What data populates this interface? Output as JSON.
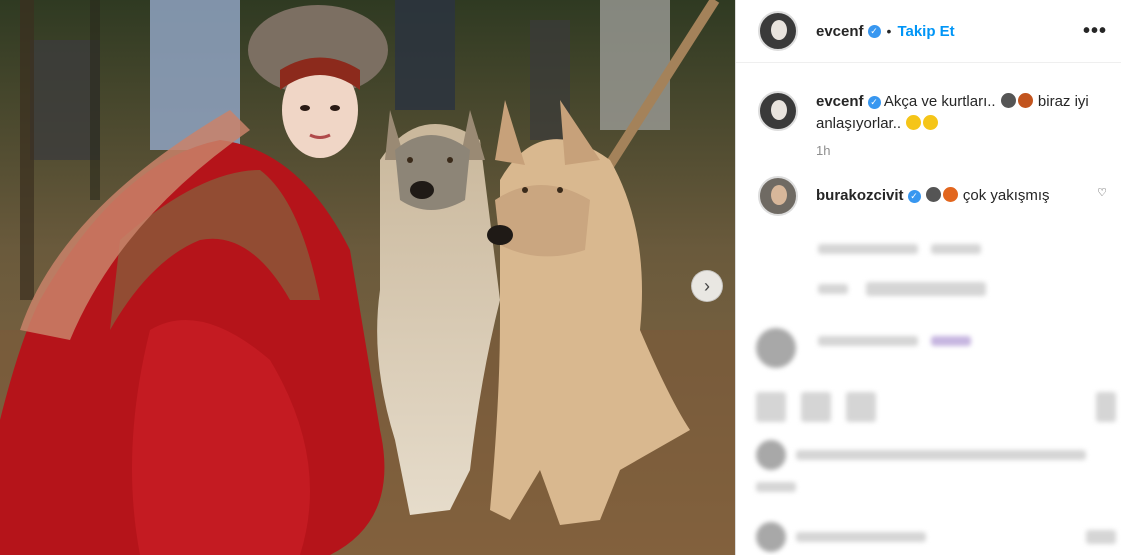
{
  "post": {
    "author": "evcenf",
    "follow_label": "Takip Et",
    "dot": "•",
    "more_label": "•••",
    "next_label": "›",
    "caption": {
      "username": "evcenf",
      "text": "Akça ve kurtları..",
      "text2": "biraz iyi anlaşıyorlar..",
      "time": "1h"
    },
    "comments": [
      {
        "username": "burakozcivit",
        "text": "çok yakışmış",
        "heart": "♡"
      }
    ],
    "colors": {
      "accent": "#0095f6",
      "verified": "#3897f0"
    }
  }
}
